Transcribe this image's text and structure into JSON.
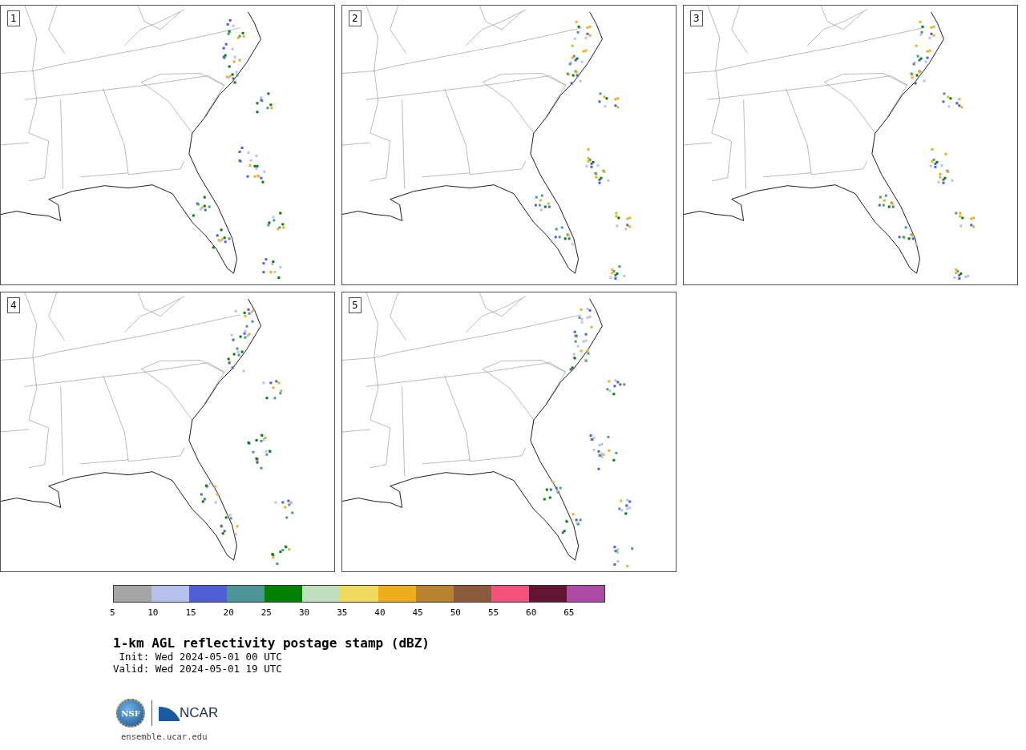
{
  "panels": [
    {
      "label": "1"
    },
    {
      "label": "2"
    },
    {
      "label": "3"
    },
    {
      "label": "4"
    },
    {
      "label": "5"
    }
  ],
  "colorbar": {
    "segments": [
      {
        "color": "#a5a5a5"
      },
      {
        "color": "#b6c0ec"
      },
      {
        "color": "#505ed6"
      },
      {
        "color": "#4e9599"
      },
      {
        "color": "#008000"
      },
      {
        "color": "#bfdfbf"
      },
      {
        "color": "#efda5c"
      },
      {
        "color": "#eead1a"
      },
      {
        "color": "#b8822f"
      },
      {
        "color": "#8b5a3d"
      },
      {
        "color": "#f4527b"
      },
      {
        "color": "#611533"
      },
      {
        "color": "#ad4aa6"
      }
    ],
    "ticks": [
      "5",
      "10",
      "15",
      "20",
      "25",
      "30",
      "35",
      "40",
      "45",
      "50",
      "55",
      "60",
      "65"
    ]
  },
  "title": "1-km AGL reflectivity postage stamp (dBZ)",
  "init": " Init: Wed 2024-05-01 00 UTC",
  "valid": "Valid: Wed 2024-05-01 19 UTC",
  "logos": {
    "nsf": "NSF",
    "ncar": "NCAR"
  },
  "url": "ensemble.ucar.edu"
}
